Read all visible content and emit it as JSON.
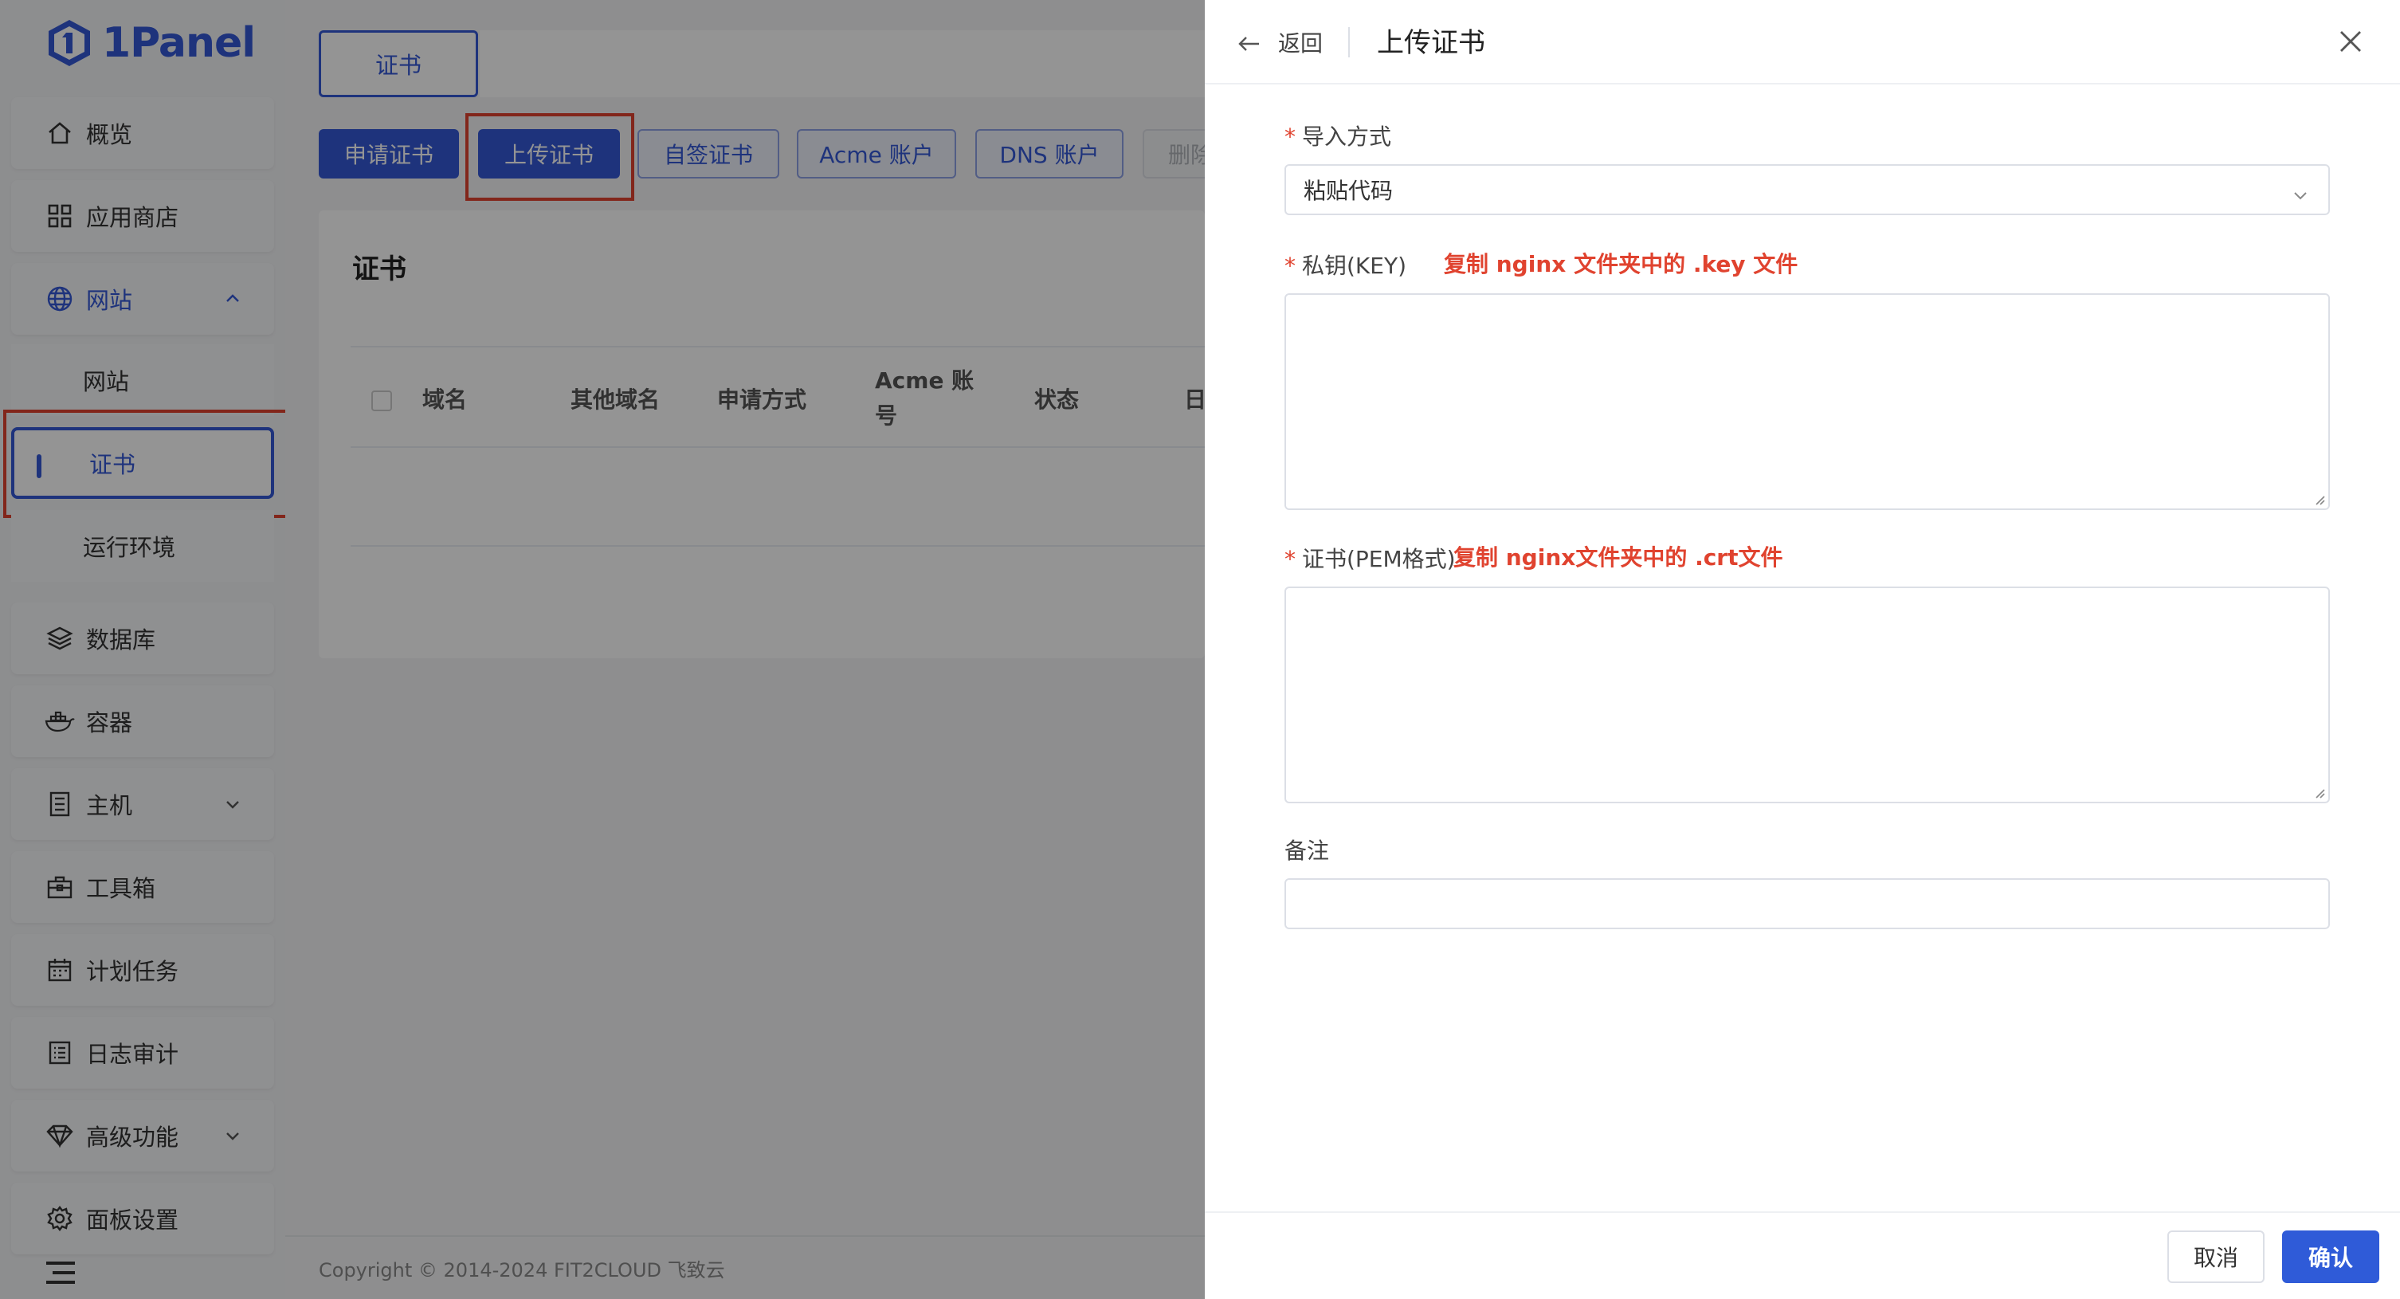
{
  "app": {
    "logo_text": "1Panel"
  },
  "sidebar": {
    "items": [
      {
        "label": "概览",
        "icon": "home-icon"
      },
      {
        "label": "应用商店",
        "icon": "grid-icon"
      },
      {
        "label": "网站",
        "icon": "globe-icon",
        "expanded": true
      },
      {
        "label": "网站",
        "sub": true
      },
      {
        "label": "证书",
        "sub": true,
        "active": true
      },
      {
        "label": "运行环境",
        "sub": true
      },
      {
        "label": "数据库",
        "icon": "layers-icon"
      },
      {
        "label": "容器",
        "icon": "docker-icon"
      },
      {
        "label": "主机",
        "icon": "server-icon"
      },
      {
        "label": "工具箱",
        "icon": "toolbox-icon"
      },
      {
        "label": "计划任务",
        "icon": "calendar-icon"
      },
      {
        "label": "日志审计",
        "icon": "log-icon"
      },
      {
        "label": "高级功能",
        "icon": "diamond-icon"
      },
      {
        "label": "面板设置",
        "icon": "gear-icon"
      }
    ]
  },
  "main": {
    "tab": "证书",
    "buttons": [
      "申请证书",
      "上传证书",
      "自签证书",
      "Acme 账户",
      "DNS 账户",
      "删除"
    ],
    "card_title": "证书",
    "columns": [
      "域名",
      "其他域名",
      "申请方式",
      "Acme 账号",
      "状态",
      "日"
    ],
    "footer": "Copyright © 2014-2024 FIT2CLOUD 飞致云"
  },
  "drawer": {
    "back_label": "返回",
    "title": "上传证书",
    "import_label": "导入方式",
    "import_value": "粘贴代码",
    "key_label": "私钥(KEY)",
    "key_note": "复制 nginx 文件夹中的 .key 文件",
    "cert_label": "证书(PEM格式)",
    "cert_note": "复制 nginx文件夹中的 .crt文件",
    "remark_label": "备注",
    "cancel": "取消",
    "confirm": "确认"
  },
  "colors": {
    "primary": "#3559d6",
    "highlight": "#e0432f"
  }
}
